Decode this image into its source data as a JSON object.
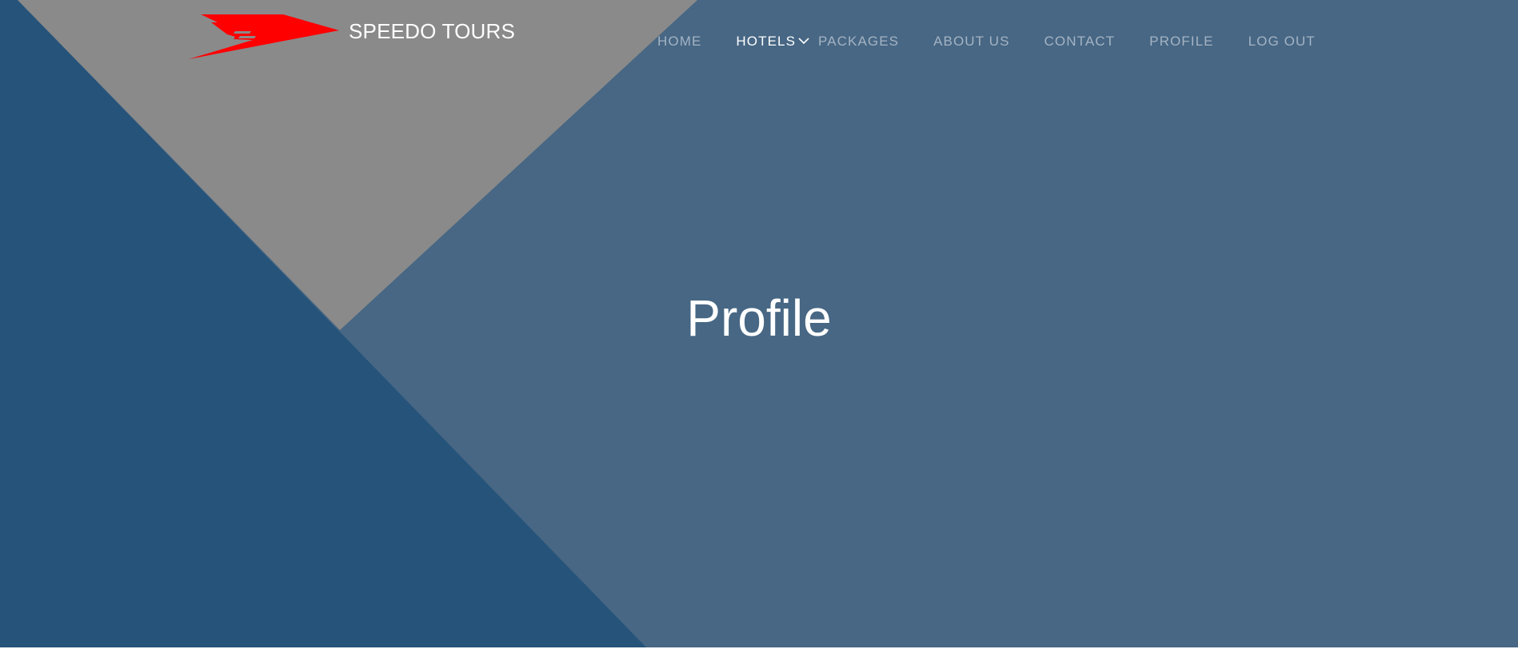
{
  "brand": {
    "name": "SPEEDO TOURS",
    "logo_icon": "speedo-wing-logo-icon",
    "logo_color": "#ff0000"
  },
  "nav": {
    "items": [
      {
        "label": "HOME",
        "active": false
      },
      {
        "label": "HOTELS",
        "active": true,
        "has_dropdown": true,
        "icon": "chevron-down-icon"
      },
      {
        "label": "PACKAGES",
        "active": false
      },
      {
        "label": "ABOUT US",
        "active": false
      },
      {
        "label": "CONTACT",
        "active": false
      },
      {
        "label": "PROFILE",
        "active": false
      },
      {
        "label": "LOG OUT",
        "active": false
      }
    ]
  },
  "hero": {
    "title": "Profile",
    "colors": {
      "base": "#476784",
      "dark_triangle": "#26537a",
      "grey_triangle": "#8a8a8a"
    }
  }
}
